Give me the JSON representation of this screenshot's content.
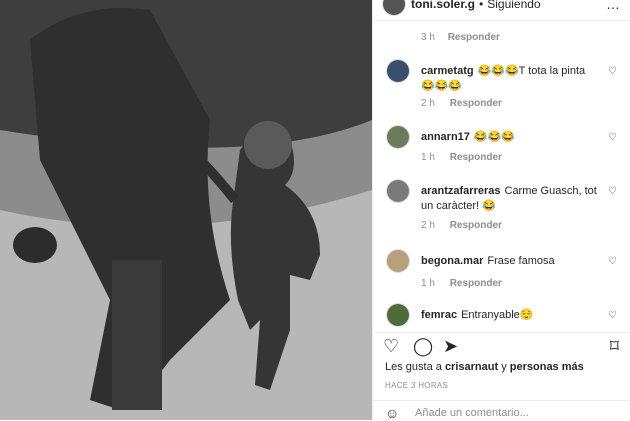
{
  "header": {
    "username": "toni.soler.g",
    "separator": "•",
    "follow_label": "Siguiendo",
    "more_label": "…"
  },
  "top_meta": {
    "time": "3 h",
    "reply": "Responder"
  },
  "comments": [
    {
      "user": "carmetatg",
      "text": "😂😂😂T tota la pinta 😂😂😂",
      "time": "2 h",
      "reply": "Responder",
      "avatar_color": "#3a4f6b"
    },
    {
      "user": "annarn17",
      "text": "😂😂😂",
      "time": "1 h",
      "reply": "Responder",
      "avatar_color": "#6b7b5c"
    },
    {
      "user": "arantzafarreras",
      "text": "Carme Guasch, tot un caràcter! 😂",
      "time": "2 h",
      "reply": "Responder",
      "avatar_color": "#7a7a7a"
    },
    {
      "user": "begona.mar",
      "text": "Frase famosa",
      "time": "1 h",
      "reply": "Responder",
      "avatar_color": "#b7a07a"
    },
    {
      "user": "femrac",
      "text": "Entranyable😌",
      "time": "",
      "reply": "",
      "avatar_color": "#4f6b3a"
    }
  ],
  "actions": {
    "like_icon": "heart-icon",
    "comment_icon": "comment-icon",
    "share_icon": "send-icon",
    "save_icon": "bookmark-icon"
  },
  "likes": {
    "prefix": "Les gusta a ",
    "user": "crisarnaut",
    "middle": " y ",
    "more": "personas más"
  },
  "post_time": "HACE 3 HORAS",
  "add_comment": {
    "placeholder": "Añade un comentario..."
  },
  "colors": {
    "muted": "#8e8e8e",
    "text": "#262626",
    "border": "#efefef"
  }
}
